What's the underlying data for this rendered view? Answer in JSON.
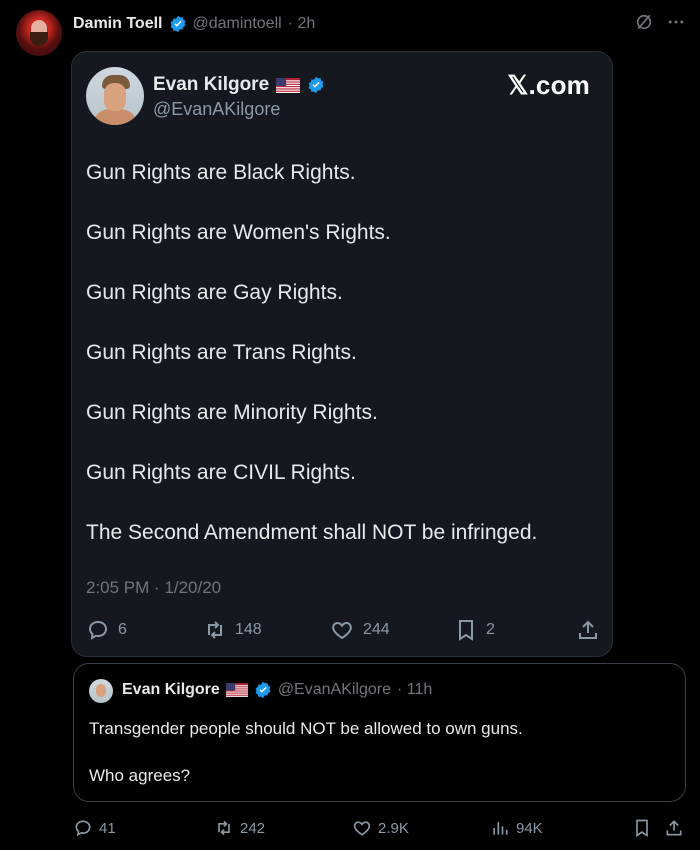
{
  "post": {
    "author_name": "Damin Toell",
    "author_handle": "@damintoell",
    "time": "· 2h"
  },
  "card": {
    "name": "Evan Kilgore",
    "handle": "@EvanAKilgore",
    "brand": "𝕏.com",
    "lines": [
      "Gun Rights are Black Rights.",
      "Gun Rights are Women's Rights.",
      "Gun Rights are Gay Rights.",
      "Gun Rights are Trans Rights.",
      "Gun Rights are Minority Rights.",
      "Gun Rights are CIVIL Rights.",
      "The Second Amendment shall NOT be infringed."
    ],
    "timestamp": "2:05 PM · 1/20/20",
    "stats": {
      "replies": "6",
      "reposts": "148",
      "likes": "244",
      "bookmarks": "2"
    }
  },
  "quote": {
    "name": "Evan Kilgore",
    "handle": "@EvanAKilgore",
    "time": "· 11h",
    "line1": "Transgender people should NOT be allowed to own guns.",
    "line2": "Who agrees?"
  },
  "stats": {
    "replies": "41",
    "reposts": "242",
    "likes": "2.9K",
    "views": "94K"
  },
  "colors": {
    "background": "#000000",
    "card": "#15191f",
    "verified": "#1d9bf0",
    "muted": "#71767b"
  },
  "icons": [
    "grok-icon",
    "more-icon",
    "verified-badge-icon",
    "us-flag-icon",
    "reply-icon",
    "repost-icon",
    "like-icon",
    "bookmark-icon",
    "share-icon",
    "views-icon"
  ]
}
